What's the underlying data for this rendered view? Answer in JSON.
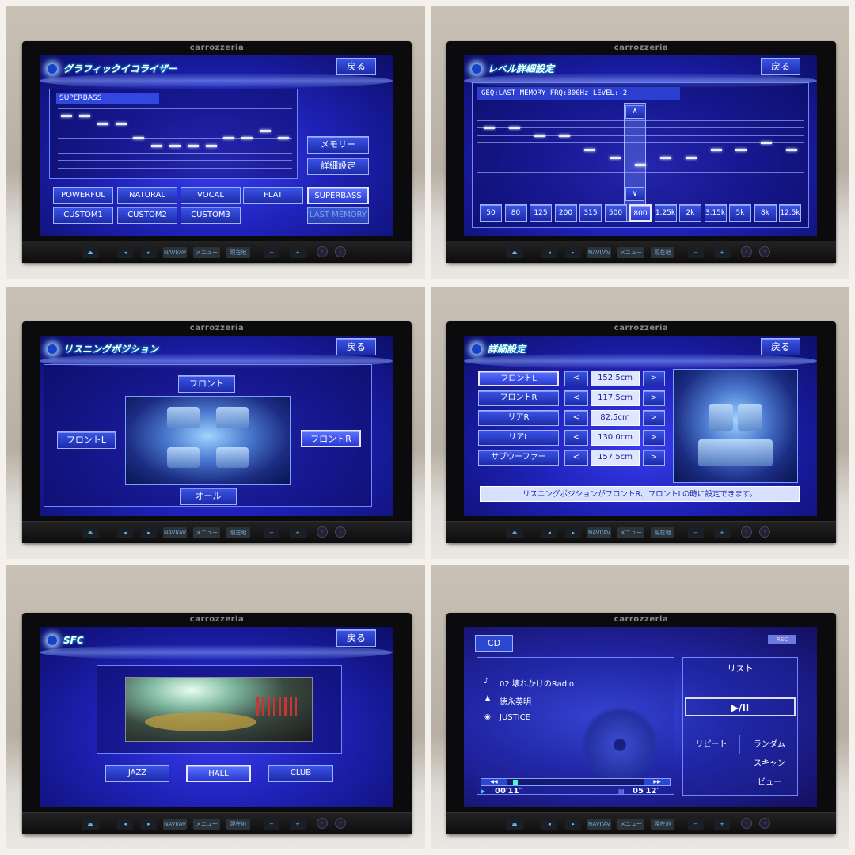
{
  "device": {
    "brand": "carrozzeria",
    "hw_buttons": {
      "navi_av": "NAVI/AV",
      "menu": "メニュー",
      "current_location": "現在地",
      "minus": "−",
      "plus": "+",
      "eject": "⏏",
      "prev": "◂",
      "next": "▸"
    }
  },
  "colors": {
    "screen_accent": "#2a36d8",
    "button_border": "#9db3ff"
  },
  "eq_screen": {
    "title": "グラフィックイコライザー",
    "back": "戻る",
    "preset_label": "SUPERBASS",
    "levels": [
      3,
      3,
      2,
      2,
      0,
      -1,
      -1,
      -1,
      -1,
      0,
      0,
      1,
      0
    ],
    "memory": "メモリー",
    "detail": "詳細設定",
    "presets": [
      "POWERFUL",
      "NATURAL",
      "VOCAL",
      "FLAT",
      "SUPERBASS",
      "CUSTOM1",
      "CUSTOM2",
      "CUSTOM3",
      "LAST MEMORY"
    ],
    "selected": "SUPERBASS",
    "disabled": "LAST MEMORY"
  },
  "level_screen": {
    "title": "レベル詳細設定",
    "back": "戻る",
    "info": "GEQ:LAST MEMORY  FRQ:800Hz   LEVEL:-2",
    "frequencies": [
      "50",
      "80",
      "125",
      "200",
      "315",
      "500",
      "800",
      "1.25k",
      "2k",
      "3.15k",
      "5k",
      "8k",
      "12.5k"
    ],
    "levels": [
      3,
      3,
      2,
      2,
      0,
      -1,
      -2,
      -1,
      -1,
      0,
      0,
      1,
      0
    ],
    "selected": "800",
    "up": "∧",
    "down": "∨"
  },
  "listening_screen": {
    "title": "リスニングポジション",
    "back": "戻る",
    "front": "フロント",
    "front_l": "フロントL",
    "front_r": "フロントR",
    "all": "オール"
  },
  "detail_screen": {
    "title": "詳細設定",
    "back": "戻る",
    "rows": [
      {
        "label": "フロントL",
        "value": "152.5cm"
      },
      {
        "label": "フロントR",
        "value": "117.5cm"
      },
      {
        "label": "リアR",
        "value": "82.5cm"
      },
      {
        "label": "リアL",
        "value": "130.0cm"
      },
      {
        "label": "サブウーファー",
        "value": "157.5cm"
      }
    ],
    "left": "<",
    "right": ">",
    "note": "リスニングポジションがフロントR、フロントLの時に設定できます。"
  },
  "sfc_screen": {
    "title": "SFC",
    "back": "戻る",
    "modes": [
      "JAZZ",
      "HALL",
      "CLUB"
    ],
    "selected": "HALL"
  },
  "cd_screen": {
    "source": "CD",
    "rec": "REC",
    "track": "02 壊れかけのRadio",
    "artist": "徳永英明",
    "album": "JUSTICE",
    "elapsed": "00′11″",
    "total": "05′12″",
    "progress": 0.035,
    "rew": "◀◀",
    "ff": "▶▶",
    "list": "リスト",
    "play_pause": "▶/II",
    "repeat": "リピート",
    "random": "ランダム",
    "scan": "スキャン",
    "view": "ビュー"
  }
}
